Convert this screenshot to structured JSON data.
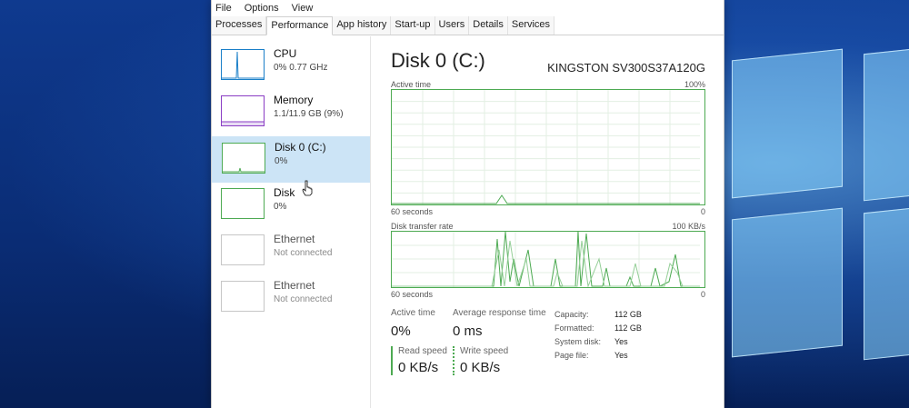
{
  "menu": [
    "File",
    "Options",
    "View"
  ],
  "tabs": [
    "Processes",
    "Performance",
    "App history",
    "Start-up",
    "Users",
    "Details",
    "Services"
  ],
  "active_tab": "Performance",
  "sidebar": [
    {
      "title": "CPU",
      "sub": "0% 0.77 GHz",
      "color": "#1a7fc8"
    },
    {
      "title": "Memory",
      "sub": "1.1/11.9 GB (9%)",
      "color": "#8a3dc4"
    },
    {
      "title": "Disk 0 (C:)",
      "sub": "0%",
      "color": "#4daa52"
    },
    {
      "title": "Disk",
      "sub": "0%",
      "color": "#4daa52"
    },
    {
      "title": "Ethernet",
      "sub": "Not connected",
      "color": "#c6c6c6"
    },
    {
      "title": "Ethernet",
      "sub": "Not connected",
      "color": "#c6c6c6"
    }
  ],
  "main": {
    "title": "Disk 0 (C:)",
    "model": "KINGSTON SV300S37A120G",
    "graph1": {
      "label": "Active time",
      "max": "100%",
      "x_left": "60 seconds",
      "x_right": "0"
    },
    "graph2": {
      "label": "Disk transfer rate",
      "max": "100 KB/s",
      "x_left": "60 seconds",
      "x_right": "0"
    },
    "active_time_label": "Active time",
    "active_time_value": "0%",
    "response_label": "Average response time",
    "response_value": "0 ms",
    "read_label": "Read speed",
    "read_value": "0 KB/s",
    "write_label": "Write speed",
    "write_value": "0 KB/s",
    "props": [
      {
        "k": "Capacity:",
        "v": "112 GB"
      },
      {
        "k": "Formatted:",
        "v": "112 GB"
      },
      {
        "k": "System disk:",
        "v": "Yes"
      },
      {
        "k": "Page file:",
        "v": "Yes"
      }
    ]
  },
  "colors": {
    "disk_green": "#4daa52",
    "selected_bg": "#cce4f6"
  }
}
